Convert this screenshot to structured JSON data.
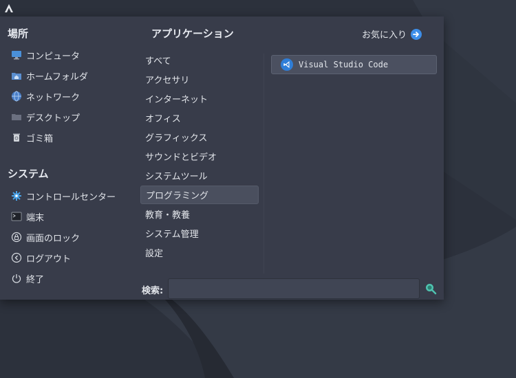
{
  "places": {
    "title": "場所",
    "items": [
      {
        "label": "コンピュータ",
        "icon": "computer-icon"
      },
      {
        "label": "ホームフォルダ",
        "icon": "home-folder-icon"
      },
      {
        "label": "ネットワーク",
        "icon": "network-icon"
      },
      {
        "label": "デスクトップ",
        "icon": "desktop-folder-icon"
      },
      {
        "label": "ゴミ箱",
        "icon": "trash-icon"
      }
    ]
  },
  "system": {
    "title": "システム",
    "items": [
      {
        "label": "コントロールセンター",
        "icon": "control-center-icon"
      },
      {
        "label": "端末",
        "icon": "terminal-icon"
      },
      {
        "label": "画面のロック",
        "icon": "lock-icon"
      },
      {
        "label": "ログアウト",
        "icon": "logout-icon"
      },
      {
        "label": "終了",
        "icon": "power-icon"
      }
    ]
  },
  "applications": {
    "title": "アプリケーション",
    "categories": [
      "すべて",
      "アクセサリ",
      "インターネット",
      "オフィス",
      "グラフィックス",
      "サウンドとビデオ",
      "システムツール",
      "プログラミング",
      "教育・教養",
      "システム管理",
      "設定"
    ],
    "selected_category": "プログラミング",
    "apps": [
      {
        "label": "Visual Studio Code",
        "icon": "vscode-icon"
      }
    ]
  },
  "favorites_label": "お気に入り",
  "search": {
    "label": "検索:",
    "value": ""
  },
  "colors": {
    "menu_bg": "#383c4a",
    "accent_blue": "#3d8ee8",
    "search_icon": "#4fc3b0"
  }
}
